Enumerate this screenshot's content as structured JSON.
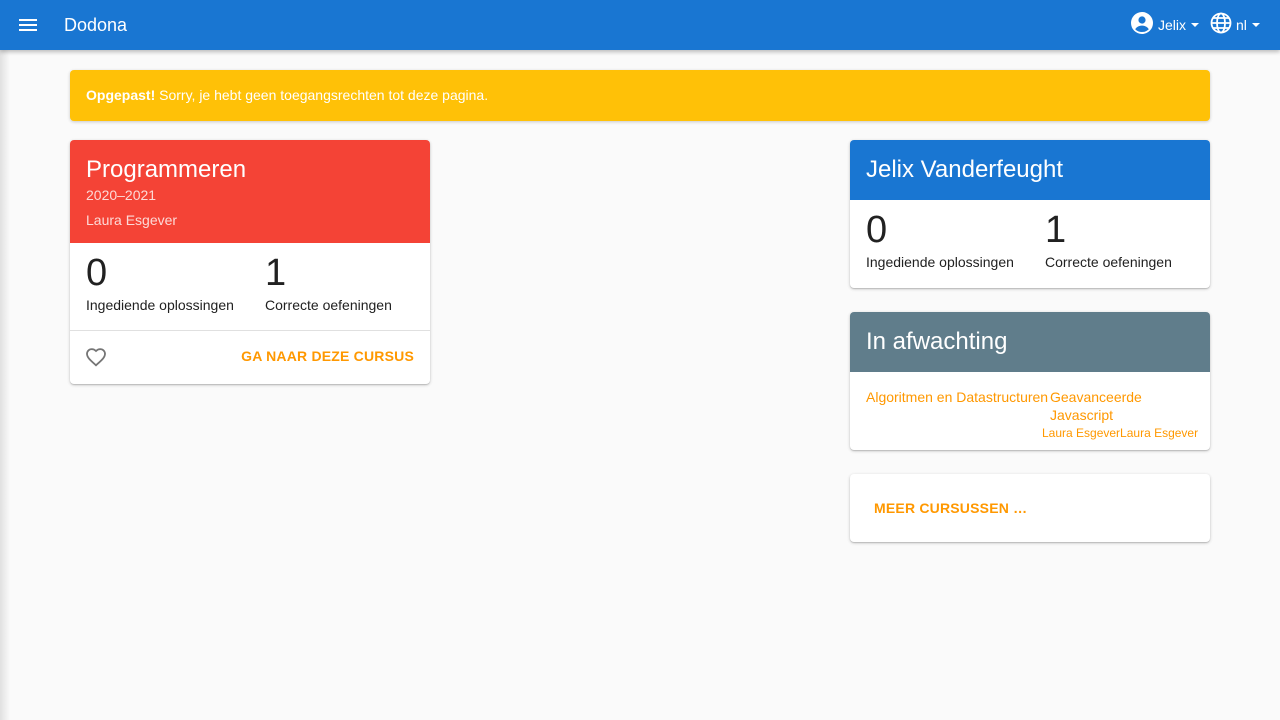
{
  "appbar": {
    "title": "Dodona",
    "user_label": "Jelix",
    "lang_label": "nl",
    "color": "#1976d2"
  },
  "alert": {
    "strong": "Opgepast!",
    "message": " Sorry, je hebt geen toegangsrechten tot deze pagina.",
    "color": "#ffc107"
  },
  "course_card": {
    "title": "Programmeren",
    "year": "2020–2021",
    "teacher": "Laura Esgever",
    "color": "#f44336",
    "stats": [
      {
        "value": "0",
        "label": "Ingediende oplossingen"
      },
      {
        "value": "1",
        "label": "Correcte oefeningen"
      }
    ],
    "favorite_icon": "heart-outline-icon",
    "goto_label": "GA NAAR DEZE CURSUS"
  },
  "user_card": {
    "name": "Jelix Vanderfeught",
    "color": "#1976d2",
    "stats": [
      {
        "value": "0",
        "label": "Ingediende oplossingen"
      },
      {
        "value": "1",
        "label": "Correcte oefeningen"
      }
    ]
  },
  "pending_card": {
    "title": "In afwachting",
    "color": "#607d8b",
    "items": [
      {
        "name": "Algoritmen en Datastructuren",
        "teacher": "Laura Esgever"
      },
      {
        "name": "Geavanceerde Javascript",
        "teacher": "Laura Esgever"
      }
    ]
  },
  "more_card": {
    "link_label": "MEER CURSUSSEN …"
  }
}
